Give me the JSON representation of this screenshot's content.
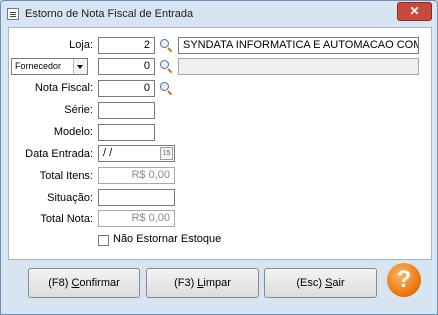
{
  "window": {
    "title": "Estorno de Nota Fiscal de Entrada",
    "close_label": "✕"
  },
  "form": {
    "loja_label": "Loja:",
    "loja_value": "2",
    "loja_name": "SYNDATA INFORMATICA E AUTOMACAO COMER",
    "fornecedor_select": "Fornecedor",
    "fornecedor_value": "0",
    "fornecedor_name": "",
    "nota_label": "Nota Fiscal:",
    "nota_value": "0",
    "serie_label": "Série:",
    "serie_value": "",
    "modelo_label": "Modelo:",
    "modelo_value": "",
    "data_label": "Data Entrada:",
    "data_value": "/ /",
    "calendar_icon_text": "15",
    "total_itens_label": "Total Itens:",
    "total_itens_value": "R$ 0,00",
    "situacao_label": "Situação:",
    "situacao_value": "",
    "total_nota_label": "Total Nota:",
    "total_nota_value": "R$ 0,00",
    "nao_estornar_label": "Não Estornar Estoque"
  },
  "buttons": {
    "confirmar_pre": "(F8) ",
    "confirmar_key": "C",
    "confirmar_post": "onfirmar",
    "limpar_pre": "(F3) ",
    "limpar_key": "L",
    "limpar_post": "impar",
    "sair_pre": "(Esc) ",
    "sair_key": "S",
    "sair_post": "air",
    "help_label": "?"
  },
  "icons": {
    "app": "document-icon",
    "search": "magnifier-icon",
    "help": "help-icon"
  },
  "colors": {
    "window_bg": "#d7e5f3",
    "close_red": "#c94a3c",
    "help_orange": "#f07a10"
  }
}
